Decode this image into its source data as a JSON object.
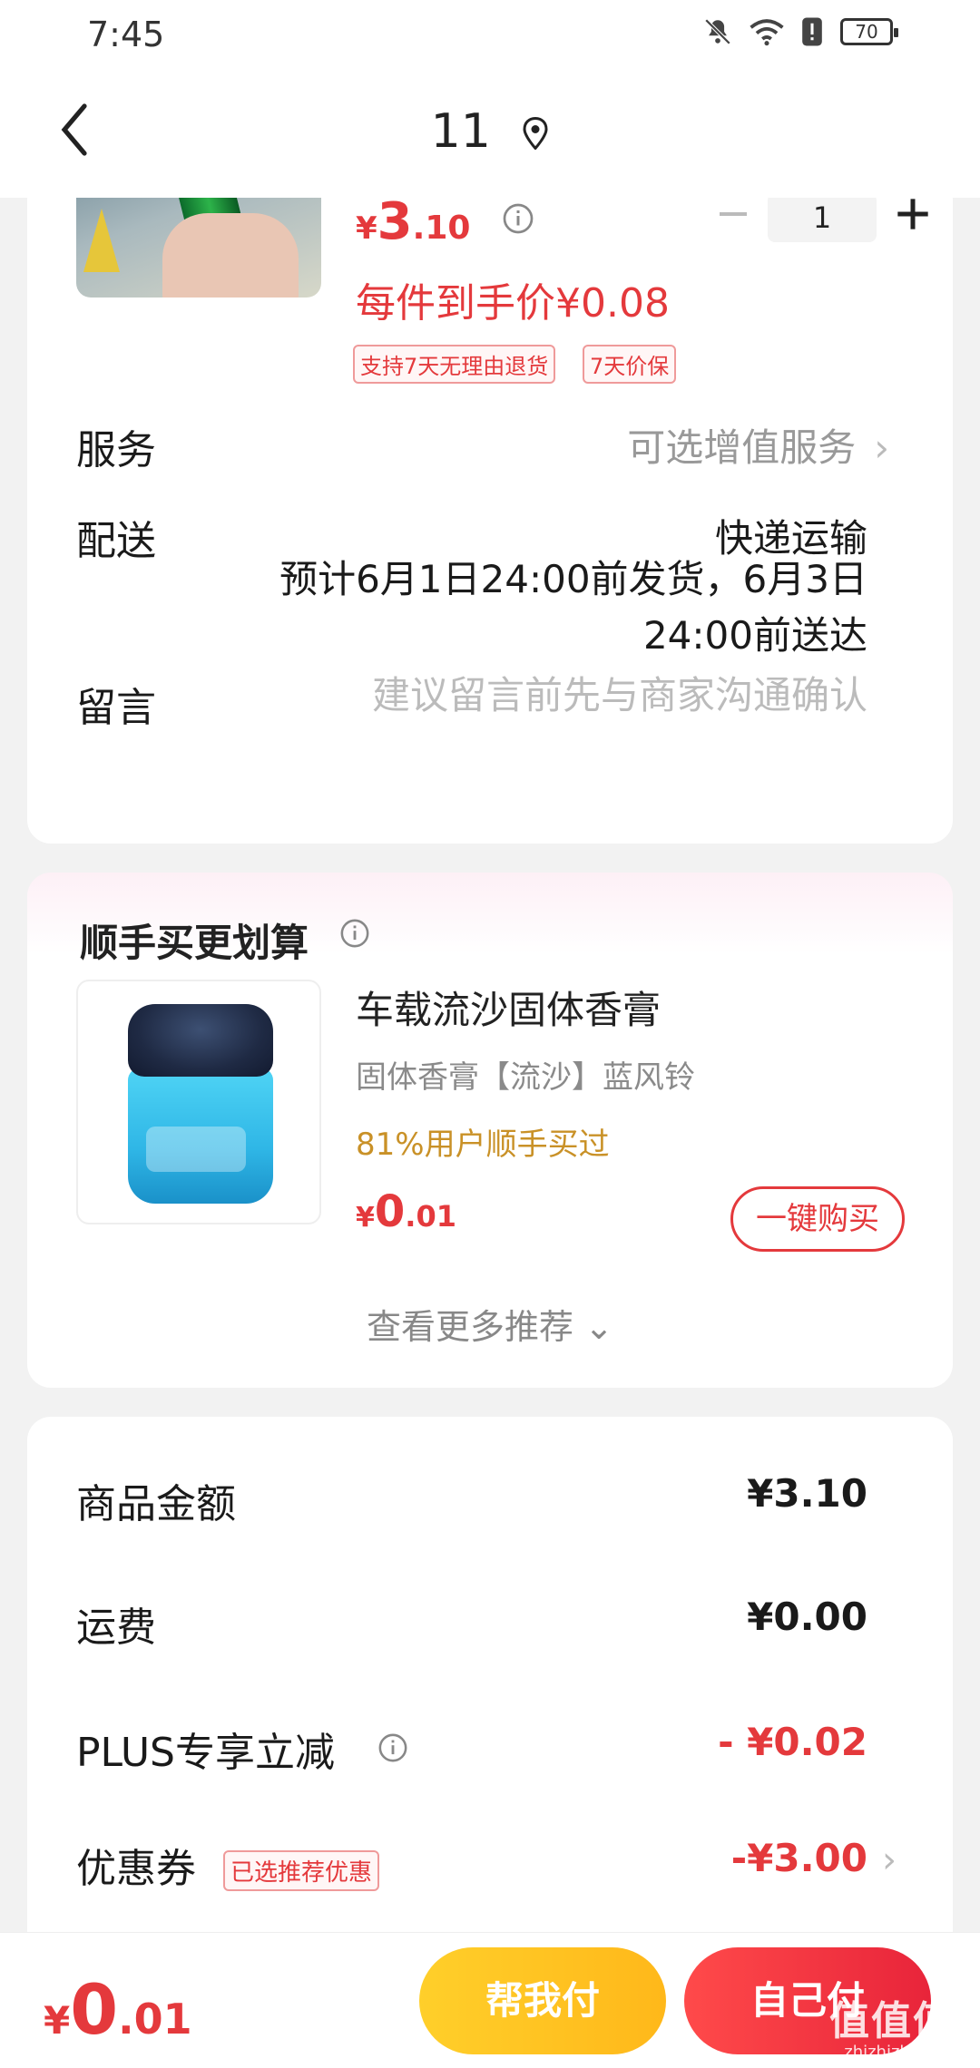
{
  "status_bar": {
    "time": "7:45",
    "battery": "70"
  },
  "header": {
    "title": "11"
  },
  "product": {
    "price_symbol": "¥",
    "price_int": "3",
    "price_dec": ".10",
    "quantity": "1",
    "unit_price": "每件到手价¥0.08",
    "tags": [
      "支持7天无理由退货",
      "7天价保"
    ]
  },
  "service": {
    "label": "服务",
    "value": "可选增值服务",
    "chevron": "›"
  },
  "delivery": {
    "label": "配送",
    "method": "快递运输",
    "eta": "预计6月1日24:00前发货，6月3日24:00前送达"
  },
  "message": {
    "label": "留言",
    "placeholder": "建议留言前先与商家沟通确认"
  },
  "recommendation": {
    "title": "顺手买更划算",
    "item_name": "车载流沙固体香膏",
    "item_spec": "固体香膏【流沙】蓝风铃",
    "social_proof": "81%用户顺手买过",
    "price_symbol": "¥",
    "price_int": "0",
    "price_dec": ".01",
    "buy_label": "一键购买",
    "more_label": "查看更多推荐",
    "more_chevron": "⌄"
  },
  "summary": {
    "goods_label": "商品金额",
    "goods_value": "¥3.10",
    "shipping_label": "运费",
    "shipping_value": "¥0.00",
    "plus_label": "PLUS专享立减",
    "plus_value": "- ¥0.02",
    "coupon_label": "优惠券",
    "coupon_tag": "已选推荐优惠",
    "coupon_value": "-¥3.00",
    "coupon_chevron": "›"
  },
  "bottom_bar": {
    "total_symbol": "¥",
    "total_int": "0",
    "total_dec": ".01",
    "help_pay_label": "帮我付",
    "self_pay_label": "自己付"
  },
  "watermark": {
    "text": "值值值",
    "url": "zhizhizhi.com"
  },
  "colors": {
    "accent_red": "#e4393c",
    "gold": "#c99127",
    "help_pay": "#ffc122",
    "self_pay": "#f03040"
  }
}
